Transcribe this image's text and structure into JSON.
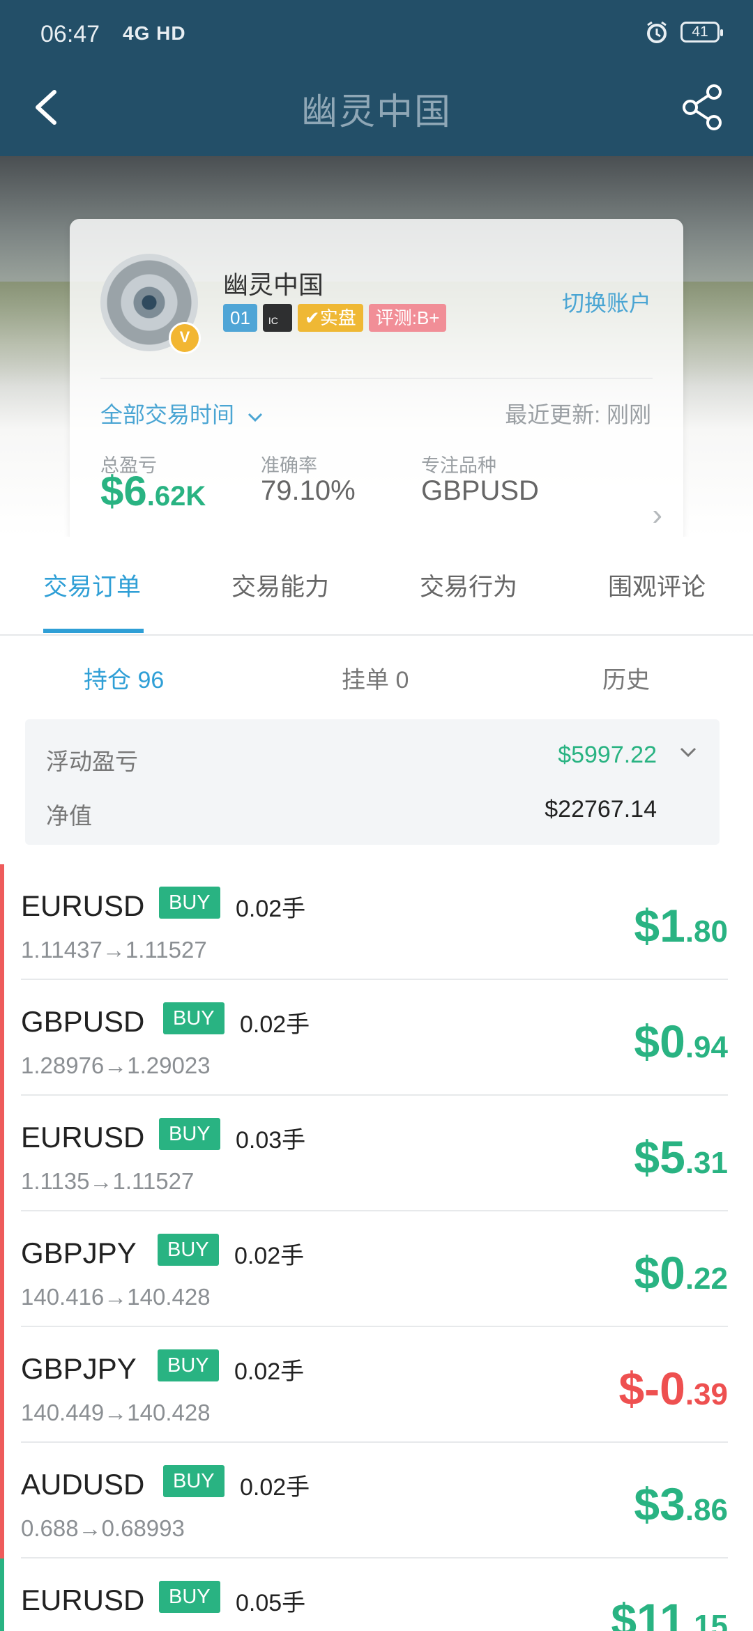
{
  "status": {
    "time": "06:47",
    "network": "4G HD",
    "battery": "41"
  },
  "header": {
    "title": "幽灵中国"
  },
  "profile": {
    "name": "幽灵中国",
    "badges": [
      "01",
      "IC",
      "实盘",
      "评测:B+"
    ],
    "switch_account": "切换账户",
    "filter": "全部交易时间",
    "updated": "最近更新: 刚刚",
    "stats": [
      {
        "label": "总盈亏",
        "value_int": "$6",
        "value_dec": ".62K"
      },
      {
        "label": "准确率",
        "value": "79.10%"
      },
      {
        "label": "专注品种",
        "value": "GBPUSD"
      }
    ]
  },
  "tabs": [
    "交易订单",
    "交易能力",
    "交易行为",
    "围观评论"
  ],
  "subtabs": [
    "持仓 96",
    "挂单 0",
    "历史"
  ],
  "summary": {
    "floating_label": "浮动盈亏",
    "floating_value": "$5997.22",
    "equity_label": "净值",
    "equity_value": "$22767.14"
  },
  "orders": [
    {
      "symbol": "EURUSD",
      "side": "BUY",
      "lots": "0.02手",
      "route": "1.11437→1.11527",
      "pnl_int": "$1",
      "pnl_dec": ".80",
      "negative": false
    },
    {
      "symbol": "GBPUSD",
      "side": "BUY",
      "lots": "0.02手",
      "route": "1.28976→1.29023",
      "pnl_int": "$0",
      "pnl_dec": ".94",
      "negative": false
    },
    {
      "symbol": "EURUSD",
      "side": "BUY",
      "lots": "0.03手",
      "route": "1.1135→1.11527",
      "pnl_int": "$5",
      "pnl_dec": ".31",
      "negative": false
    },
    {
      "symbol": "GBPJPY",
      "side": "BUY",
      "lots": "0.02手",
      "route": "140.416→140.428",
      "pnl_int": "$0",
      "pnl_dec": ".22",
      "negative": false
    },
    {
      "symbol": "GBPJPY",
      "side": "BUY",
      "lots": "0.02手",
      "route": "140.449→140.428",
      "pnl_int": "$-0",
      "pnl_dec": ".39",
      "negative": true
    },
    {
      "symbol": "AUDUSD",
      "side": "BUY",
      "lots": "0.02手",
      "route": "0.688→0.68993",
      "pnl_int": "$3",
      "pnl_dec": ".86",
      "negative": false
    },
    {
      "symbol": "EURUSD",
      "side": "BUY",
      "lots": "0.05手",
      "route": "",
      "pnl_int": "$11",
      "pnl_dec": ".15",
      "negative": false
    }
  ],
  "colors": {
    "header": "#234f68",
    "accent": "#2f9fd6",
    "profit": "#29b382",
    "loss": "#ee5050"
  }
}
